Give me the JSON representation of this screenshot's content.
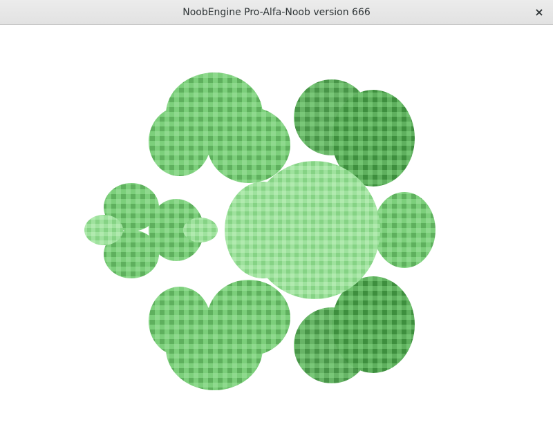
{
  "window": {
    "title": "NoobEngine Pro-Alfa-Noob version 666",
    "close_glyph": "×"
  },
  "scene": {
    "object": "3D fractal of green cubes",
    "colors": {
      "background": "#ffffff",
      "light": "#9fe29e",
      "mid": "#7ccf7b",
      "dark": "#4fa54f",
      "darker": "#3e8f3e"
    }
  }
}
